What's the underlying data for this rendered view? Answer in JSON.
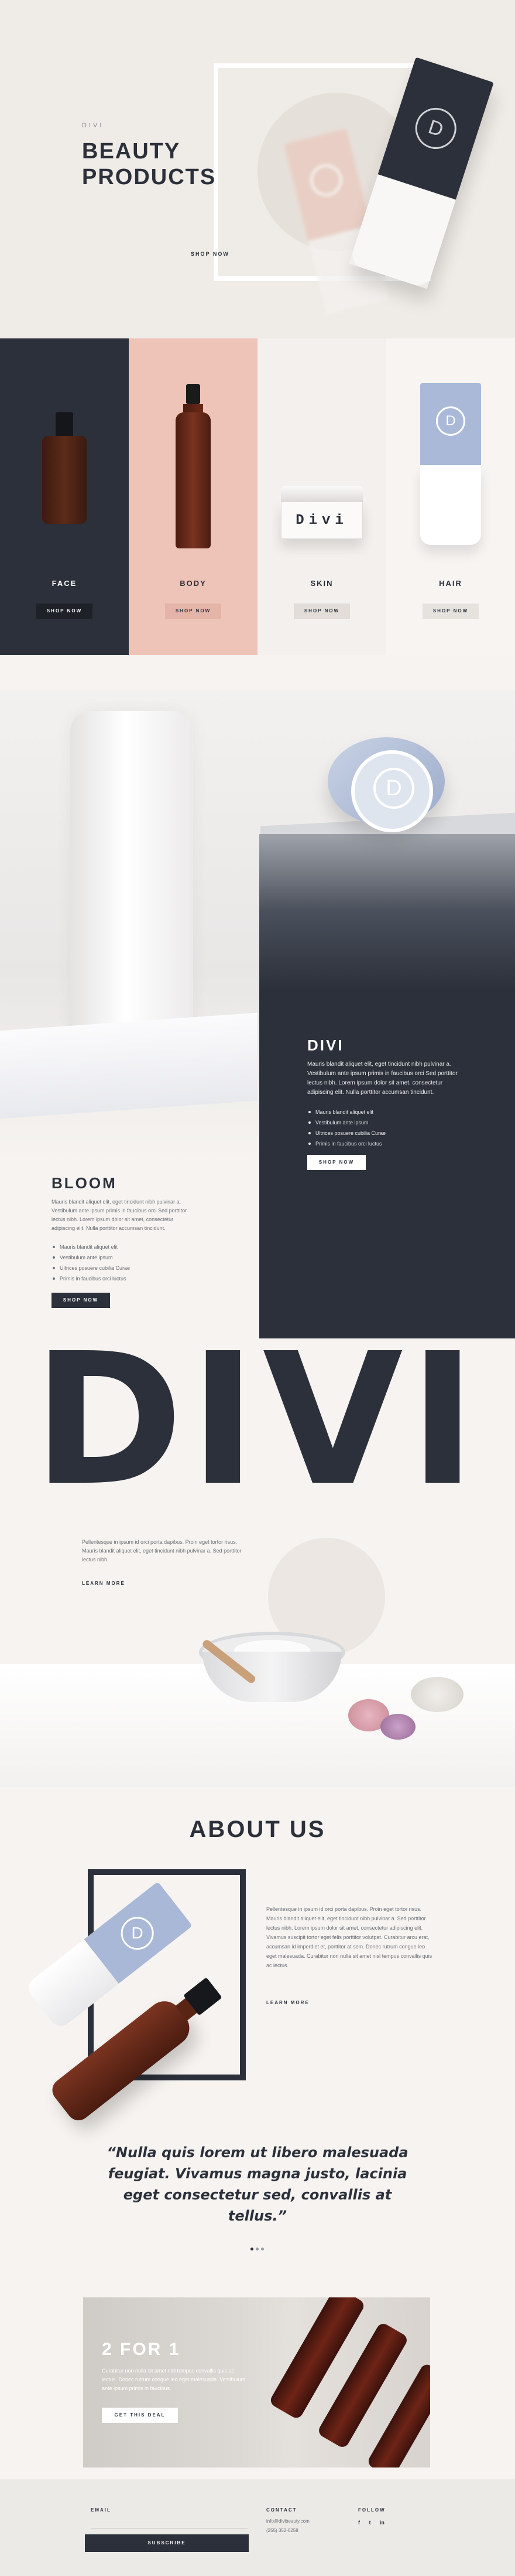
{
  "hero": {
    "eyebrow": "DIVI",
    "title_line1": "BEAUTY",
    "title_line2": "PRODUCTS",
    "cta": "SHOP NOW",
    "tube_logo": "D"
  },
  "categories": [
    {
      "label": "FACE",
      "button": "SHOP NOW",
      "bg": "#2b303a"
    },
    {
      "label": "BODY",
      "button": "SHOP NOW",
      "bg": "#efc4b8"
    },
    {
      "label": "SKIN",
      "button": "SHOP NOW",
      "bg": "#f3f0ed",
      "jar_text": "Divi"
    },
    {
      "label": "HAIR",
      "button": "SHOP NOW",
      "bg": "#f7f4f2",
      "tube_logo": "D"
    }
  ],
  "divi_panel": {
    "title": "DIVI",
    "text": "Mauris blandit aliquet elit, eget tincidunt nibh pulvinar a. Vestibulum ante ipsum primis in faucibus orci Sed porttitor lectus nibh. Lorem ipsum dolor sit amet, consectetur adipiscing elit. Nulla porttitor accumsan tincidunt.",
    "bullets": [
      "Mauris blandit aliquet elit",
      "Vestibulum ante ipsum",
      "Ultrices posuere cubilia Curae",
      "Primis in faucibus orci luctus"
    ],
    "button": "SHOP NOW",
    "jar_logo": "D"
  },
  "bloom": {
    "title": "BLOOM",
    "text": "Mauris blandit aliquet elit, eget tincidunt nibh pulvinar a. Vestibulum ante ipsum primis in faucibus orci Sed porttitor lectus nibh. Lorem ipsum dolor sit amet, consectetur adipiscing elit. Nulla porttitor accumsan tincidunt.",
    "bullets": [
      "Mauris blandit aliquet elit",
      "Vestibulum ante ipsum",
      "Ultrices posuere cubilia Curae",
      "Primis in faucibus orci luctus"
    ],
    "button": "SHOP NOW"
  },
  "big_word": "DIVI",
  "intro": {
    "text": "Pellentesque in ipsum id orci porta dapibus. Proin eget tortor risus. Mauris blandit aliquet elit, eget tincidunt nibh pulvinar a. Sed porttitor lectus nibh.",
    "link": "LEARN MORE"
  },
  "about": {
    "title": "ABOUT US",
    "text": "Pellentesque in ipsum id orci porta dapibus. Proin eget tortor risus. Mauris blandit aliquet elit, eget tincidunt nibh pulvinar a. Sed porttitor lectus nibh. Lorem ipsum dolor sit amet, consectetur adipiscing elit. Vivamus suscipit tortor eget felis porttitor volutpat. Curabitur arcu erat, accumsan id imperdiet et, porttitor at sem. Donec rutrum congue leo eget malesuada. Curabitur non nulla sit amet nisl tempus convallis quis ac lectus.",
    "link": "LEARN MORE",
    "tube_logo": "D"
  },
  "quote": {
    "text": "“Nulla quis lorem ut libero malesuada feugiat. Vivamus magna justo, lacinia eget consectetur sed, convallis at tellus.”"
  },
  "promo": {
    "title": "2 FOR 1",
    "text": "Curabitur non nulla sit amet nisl tempus convallis quis ac lectus. Donec rutrum congue leo eget malesuada. Vestibulum ante ipsum primis in faucibus.",
    "button": "GET THIS DEAL"
  },
  "footer": {
    "email_label": "EMAIL",
    "subscribe": "SUBSCRIBE",
    "contact_label": "CONTACT",
    "email": "info@divibeauty.com",
    "phone": "(255) 352-6258",
    "follow_label": "FOLLOW",
    "social": [
      "f",
      "t",
      "in"
    ]
  }
}
